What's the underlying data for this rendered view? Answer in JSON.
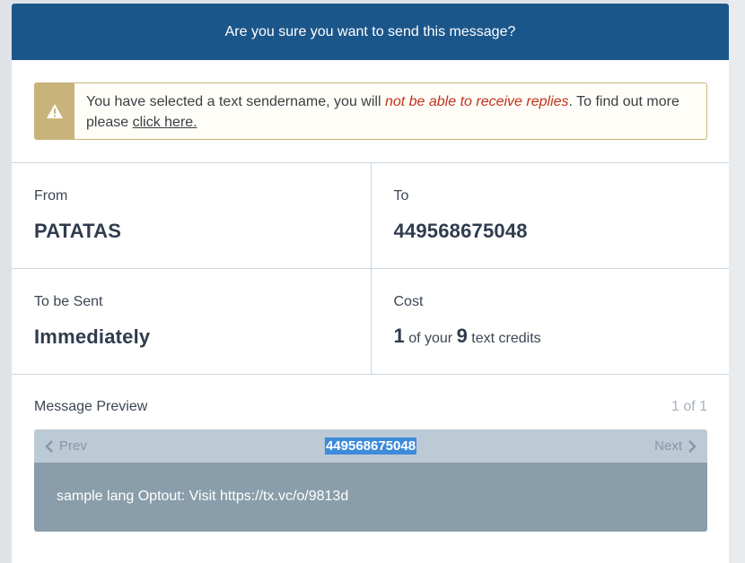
{
  "modal": {
    "title": "Are you sure you want to send this message?"
  },
  "warning": {
    "icon": "warning-triangle-icon",
    "text_before": "You have selected a text sendername, you will ",
    "text_emphasis": "not be able to receive replies",
    "text_after": ". To find out more please ",
    "link_text": "click here.",
    "color_border": "#c8b37a",
    "color_emphasis": "#c0321b"
  },
  "details": {
    "from_label": "From",
    "from_value": "PATATAS",
    "to_label": "To",
    "to_value": "449568675048",
    "send_label": "To be Sent",
    "send_value": "Immediately",
    "cost_label": "Cost",
    "cost_amount": "1",
    "cost_mid": "of your",
    "cost_total": "9",
    "cost_unit": "text credits"
  },
  "preview": {
    "title": "Message Preview",
    "count": "1 of 1",
    "prev_label": "Prev",
    "next_label": "Next",
    "recipient": "449568675048",
    "body": "sample lang Optout: Visit https://tx.vc/o/9813d"
  },
  "colors": {
    "header": "#1b568b",
    "nav_bar": "#bccad6",
    "preview_bg": "#8a9daa"
  }
}
